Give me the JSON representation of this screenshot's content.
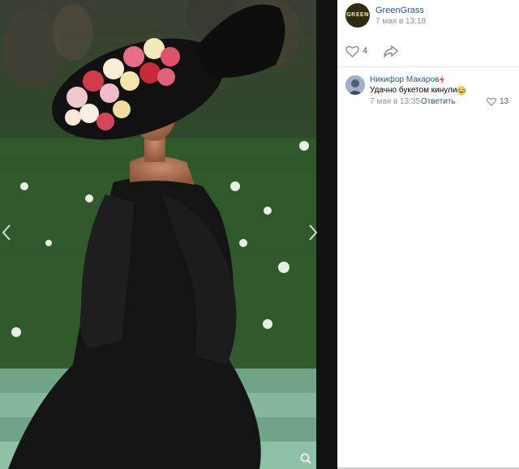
{
  "post": {
    "author": "GreenGrass",
    "date": "7 мая в 13:18",
    "avatar_text": "GREEN",
    "likes": "4"
  },
  "comment": {
    "author": "Никифор Макаров",
    "text": "Удачно букетом кинули",
    "date": "7 мая в 13:35",
    "reply_label": "Ответить",
    "likes": "13"
  },
  "colors": {
    "link": "#2a5885",
    "muted": "#939393",
    "photo_background": "#1b1f1a"
  },
  "icons": [
    "chevron-left-icon",
    "chevron-right-icon",
    "zoom-icon",
    "heart-icon",
    "share-icon",
    "lightning-icon",
    "laughing-emoji-icon"
  ]
}
